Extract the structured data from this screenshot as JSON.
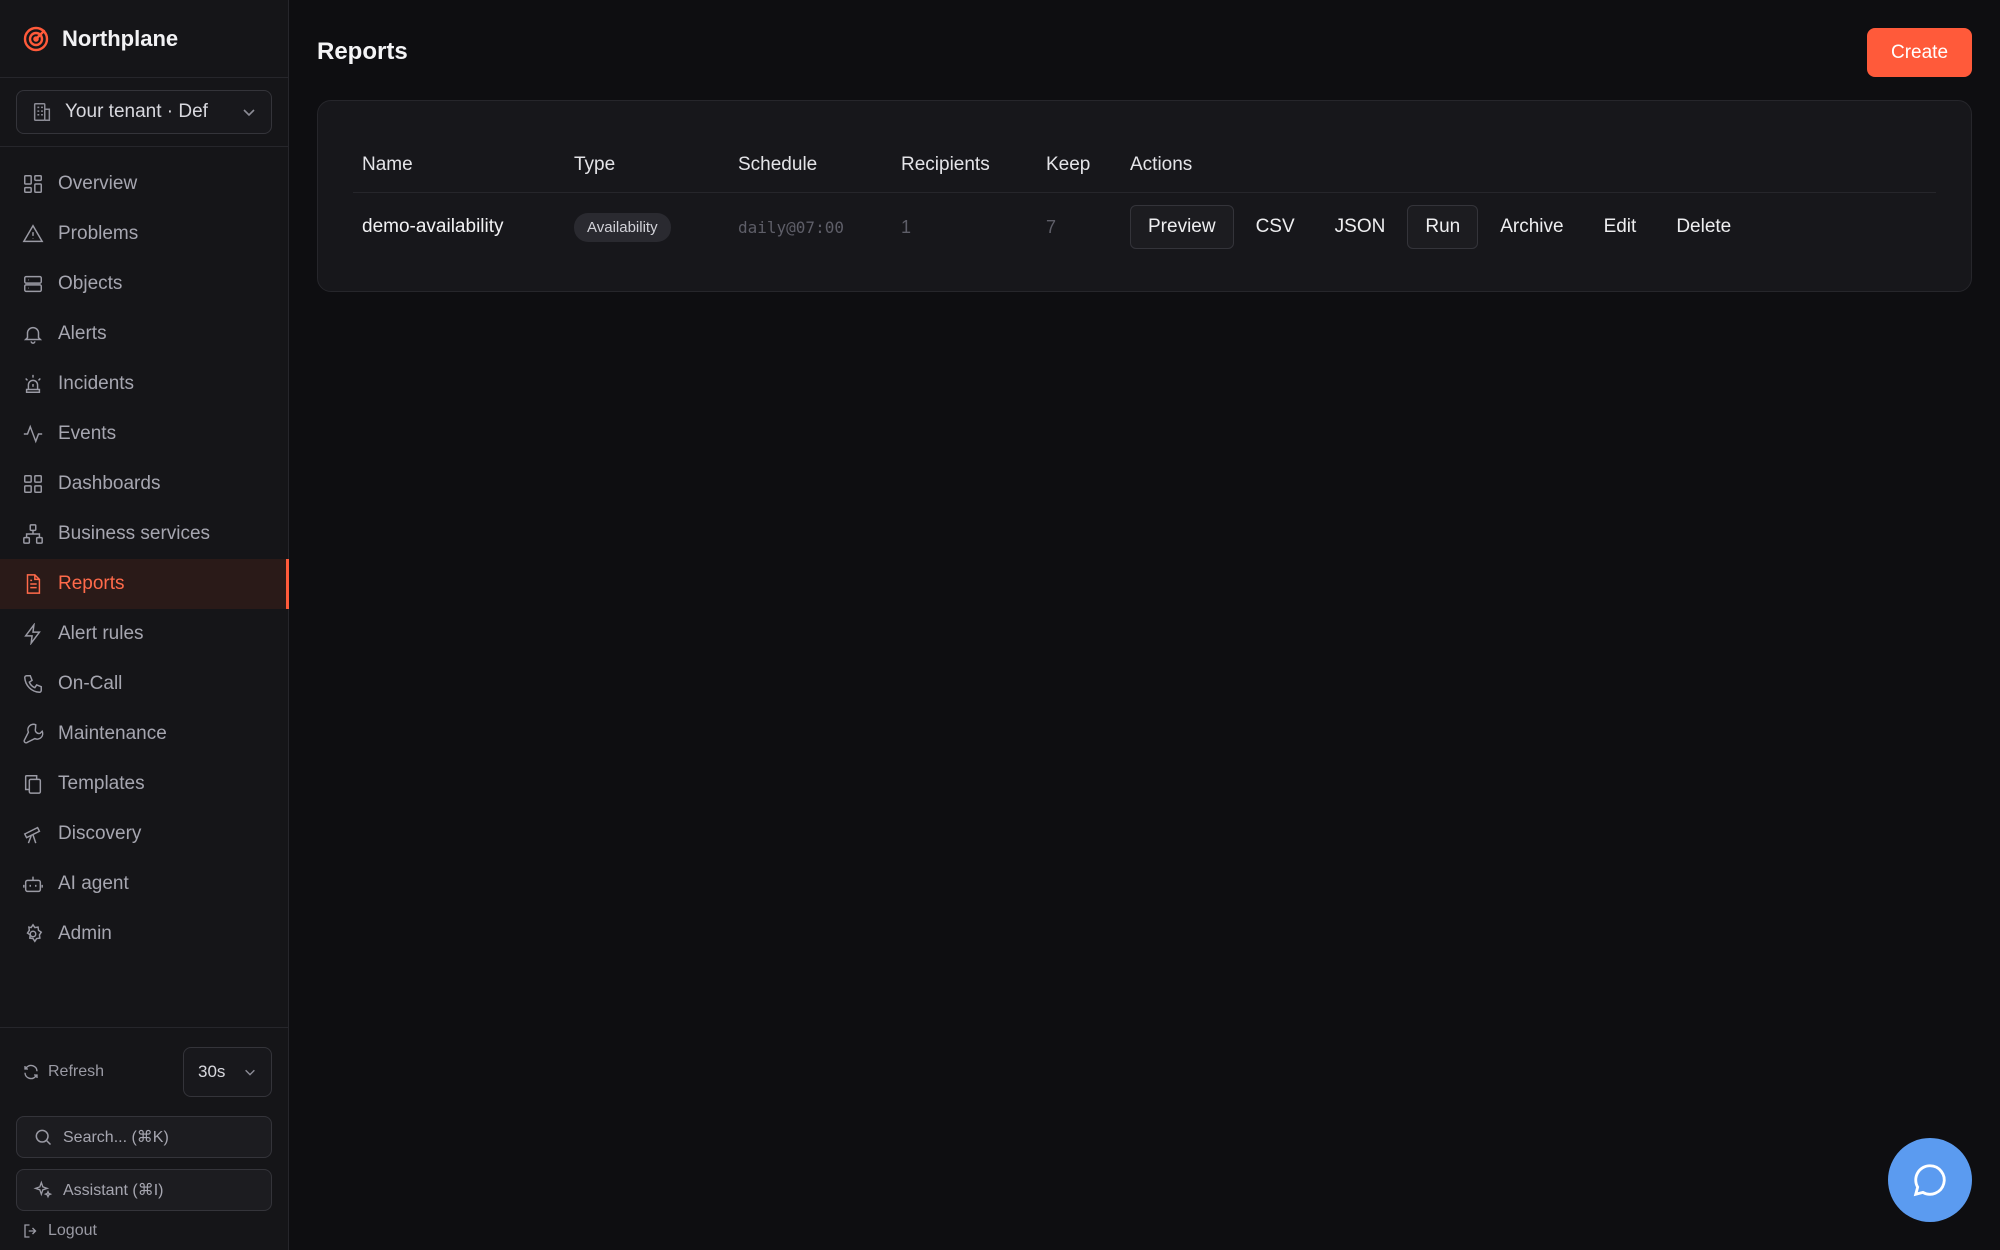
{
  "app": {
    "name": "Northplane"
  },
  "tenant": {
    "label": "Your tenant · Def"
  },
  "nav": [
    {
      "label": "Overview",
      "icon": "overview-icon"
    },
    {
      "label": "Problems",
      "icon": "warning-triangle-icon"
    },
    {
      "label": "Objects",
      "icon": "server-icon"
    },
    {
      "label": "Alerts",
      "icon": "bell-icon"
    },
    {
      "label": "Incidents",
      "icon": "siren-icon"
    },
    {
      "label": "Events",
      "icon": "activity-icon"
    },
    {
      "label": "Dashboards",
      "icon": "grid-icon"
    },
    {
      "label": "Business services",
      "icon": "network-icon"
    },
    {
      "label": "Reports",
      "icon": "document-icon",
      "active": true
    },
    {
      "label": "Alert rules",
      "icon": "lightning-icon"
    },
    {
      "label": "On-Call",
      "icon": "phone-icon"
    },
    {
      "label": "Maintenance",
      "icon": "wrench-icon"
    },
    {
      "label": "Templates",
      "icon": "copy-icon"
    },
    {
      "label": "Discovery",
      "icon": "telescope-icon"
    },
    {
      "label": "AI agent",
      "icon": "bot-icon"
    },
    {
      "label": "Admin",
      "icon": "gear-icon"
    }
  ],
  "sidebar_bottom": {
    "refresh_label": "Refresh",
    "interval_value": "30s",
    "search_label": "Search... (⌘K)",
    "assistant_label": "Assistant (⌘I)",
    "logout_label": "Logout"
  },
  "page": {
    "title": "Reports",
    "create_label": "Create"
  },
  "table": {
    "headers": [
      "Name",
      "Type",
      "Schedule",
      "Recipients",
      "Keep",
      "Actions"
    ],
    "rows": [
      {
        "name": "demo-availability",
        "type": "Availability",
        "schedule": "daily@07:00",
        "recipients": "1",
        "keep": "7",
        "actions": [
          "Preview",
          "CSV",
          "JSON",
          "Run",
          "Archive",
          "Edit",
          "Delete"
        ]
      }
    ]
  },
  "colors": {
    "accent": "#ff5a3a",
    "background": "#0e0e11",
    "sidebar": "#151518",
    "chat_button": "#5b9bf0"
  }
}
